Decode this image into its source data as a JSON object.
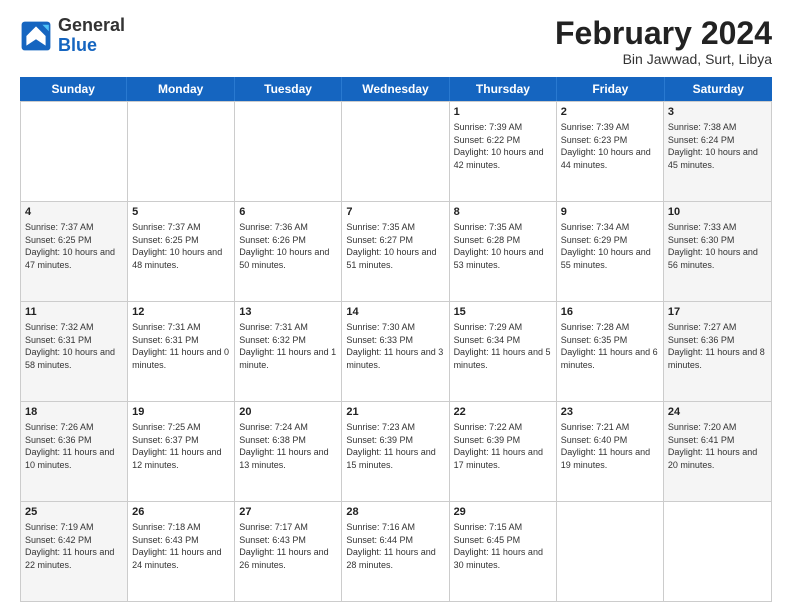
{
  "header": {
    "title": "February 2024",
    "subtitle": "Bin Jawwad, Surt, Libya",
    "logo_general": "General",
    "logo_blue": "Blue"
  },
  "days_of_week": [
    "Sunday",
    "Monday",
    "Tuesday",
    "Wednesday",
    "Thursday",
    "Friday",
    "Saturday"
  ],
  "weeks": [
    [
      {
        "day": "",
        "info": ""
      },
      {
        "day": "",
        "info": ""
      },
      {
        "day": "",
        "info": ""
      },
      {
        "day": "",
        "info": ""
      },
      {
        "day": "1",
        "info": "Sunrise: 7:39 AM\nSunset: 6:22 PM\nDaylight: 10 hours and 42 minutes."
      },
      {
        "day": "2",
        "info": "Sunrise: 7:39 AM\nSunset: 6:23 PM\nDaylight: 10 hours and 44 minutes."
      },
      {
        "day": "3",
        "info": "Sunrise: 7:38 AM\nSunset: 6:24 PM\nDaylight: 10 hours and 45 minutes."
      }
    ],
    [
      {
        "day": "4",
        "info": "Sunrise: 7:37 AM\nSunset: 6:25 PM\nDaylight: 10 hours and 47 minutes."
      },
      {
        "day": "5",
        "info": "Sunrise: 7:37 AM\nSunset: 6:25 PM\nDaylight: 10 hours and 48 minutes."
      },
      {
        "day": "6",
        "info": "Sunrise: 7:36 AM\nSunset: 6:26 PM\nDaylight: 10 hours and 50 minutes."
      },
      {
        "day": "7",
        "info": "Sunrise: 7:35 AM\nSunset: 6:27 PM\nDaylight: 10 hours and 51 minutes."
      },
      {
        "day": "8",
        "info": "Sunrise: 7:35 AM\nSunset: 6:28 PM\nDaylight: 10 hours and 53 minutes."
      },
      {
        "day": "9",
        "info": "Sunrise: 7:34 AM\nSunset: 6:29 PM\nDaylight: 10 hours and 55 minutes."
      },
      {
        "day": "10",
        "info": "Sunrise: 7:33 AM\nSunset: 6:30 PM\nDaylight: 10 hours and 56 minutes."
      }
    ],
    [
      {
        "day": "11",
        "info": "Sunrise: 7:32 AM\nSunset: 6:31 PM\nDaylight: 10 hours and 58 minutes."
      },
      {
        "day": "12",
        "info": "Sunrise: 7:31 AM\nSunset: 6:31 PM\nDaylight: 11 hours and 0 minutes."
      },
      {
        "day": "13",
        "info": "Sunrise: 7:31 AM\nSunset: 6:32 PM\nDaylight: 11 hours and 1 minute."
      },
      {
        "day": "14",
        "info": "Sunrise: 7:30 AM\nSunset: 6:33 PM\nDaylight: 11 hours and 3 minutes."
      },
      {
        "day": "15",
        "info": "Sunrise: 7:29 AM\nSunset: 6:34 PM\nDaylight: 11 hours and 5 minutes."
      },
      {
        "day": "16",
        "info": "Sunrise: 7:28 AM\nSunset: 6:35 PM\nDaylight: 11 hours and 6 minutes."
      },
      {
        "day": "17",
        "info": "Sunrise: 7:27 AM\nSunset: 6:36 PM\nDaylight: 11 hours and 8 minutes."
      }
    ],
    [
      {
        "day": "18",
        "info": "Sunrise: 7:26 AM\nSunset: 6:36 PM\nDaylight: 11 hours and 10 minutes."
      },
      {
        "day": "19",
        "info": "Sunrise: 7:25 AM\nSunset: 6:37 PM\nDaylight: 11 hours and 12 minutes."
      },
      {
        "day": "20",
        "info": "Sunrise: 7:24 AM\nSunset: 6:38 PM\nDaylight: 11 hours and 13 minutes."
      },
      {
        "day": "21",
        "info": "Sunrise: 7:23 AM\nSunset: 6:39 PM\nDaylight: 11 hours and 15 minutes."
      },
      {
        "day": "22",
        "info": "Sunrise: 7:22 AM\nSunset: 6:39 PM\nDaylight: 11 hours and 17 minutes."
      },
      {
        "day": "23",
        "info": "Sunrise: 7:21 AM\nSunset: 6:40 PM\nDaylight: 11 hours and 19 minutes."
      },
      {
        "day": "24",
        "info": "Sunrise: 7:20 AM\nSunset: 6:41 PM\nDaylight: 11 hours and 20 minutes."
      }
    ],
    [
      {
        "day": "25",
        "info": "Sunrise: 7:19 AM\nSunset: 6:42 PM\nDaylight: 11 hours and 22 minutes."
      },
      {
        "day": "26",
        "info": "Sunrise: 7:18 AM\nSunset: 6:43 PM\nDaylight: 11 hours and 24 minutes."
      },
      {
        "day": "27",
        "info": "Sunrise: 7:17 AM\nSunset: 6:43 PM\nDaylight: 11 hours and 26 minutes."
      },
      {
        "day": "28",
        "info": "Sunrise: 7:16 AM\nSunset: 6:44 PM\nDaylight: 11 hours and 28 minutes."
      },
      {
        "day": "29",
        "info": "Sunrise: 7:15 AM\nSunset: 6:45 PM\nDaylight: 11 hours and 30 minutes."
      },
      {
        "day": "",
        "info": ""
      },
      {
        "day": "",
        "info": ""
      }
    ]
  ]
}
